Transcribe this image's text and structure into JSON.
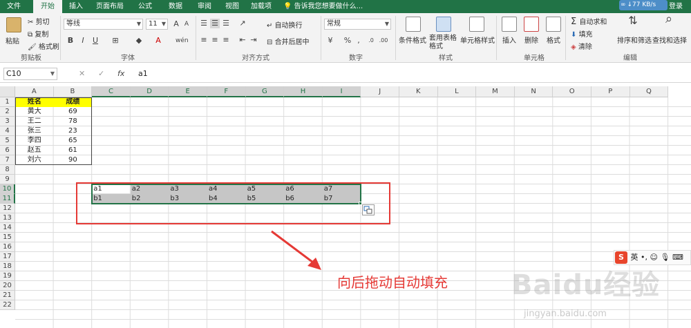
{
  "tabs": [
    "文件",
    "开始",
    "插入",
    "页面布局",
    "公式",
    "数据",
    "审阅",
    "视图",
    "加载项"
  ],
  "active_tab": "开始",
  "tell_me": "告诉我您想要做什么...",
  "network_speed": "77 KB/s",
  "login": "登录",
  "ribbon": {
    "clipboard": {
      "paste": "粘贴",
      "cut": "剪切",
      "copy": "复制",
      "format_painter": "格式刷",
      "label": "剪贴板"
    },
    "font": {
      "name": "等线",
      "size": "11",
      "bold": "B",
      "italic": "I",
      "underline": "U",
      "label": "字体"
    },
    "align": {
      "wrap": "自动换行",
      "merge": "合并后居中",
      "label": "对齐方式"
    },
    "number": {
      "format": "常规",
      "percent": "%",
      "comma": ",",
      "label": "数字"
    },
    "styles": {
      "conditional": "条件格式",
      "table": "套用表格格式",
      "cell_style": "单元格样式",
      "label": "样式"
    },
    "cells": {
      "insert": "插入",
      "delete": "删除",
      "format": "格式",
      "label": "单元格"
    },
    "editing": {
      "autosum": "自动求和",
      "fill": "填充",
      "clear": "清除",
      "sort": "排序和筛选",
      "find": "查找和选择",
      "label": "编辑"
    }
  },
  "formula_bar": {
    "name_box": "C10",
    "cancel": "✕",
    "enter": "✓",
    "fx": "fx",
    "value": "a1"
  },
  "columns": [
    "A",
    "B",
    "C",
    "D",
    "E",
    "F",
    "G",
    "H",
    "I",
    "J",
    "K",
    "L",
    "M",
    "N",
    "O",
    "P",
    "Q"
  ],
  "rows": [
    "1",
    "2",
    "3",
    "4",
    "5",
    "6",
    "7",
    "8",
    "9",
    "10",
    "11",
    "12",
    "13",
    "14",
    "15",
    "16",
    "17",
    "18",
    "19",
    "20",
    "21",
    "22"
  ],
  "table": {
    "headers": [
      "姓名",
      "成绩"
    ],
    "rows": [
      [
        "黄大",
        "69"
      ],
      [
        "王二",
        "78"
      ],
      [
        "张三",
        "23"
      ],
      [
        "李四",
        "65"
      ],
      [
        "赵五",
        "61"
      ],
      [
        "刘六",
        "90"
      ]
    ]
  },
  "fill_rows": [
    [
      "a1",
      "a2",
      "a3",
      "a4",
      "a5",
      "a6",
      "a7"
    ],
    [
      "b1",
      "b2",
      "b3",
      "b4",
      "b5",
      "b6",
      "b7"
    ]
  ],
  "annotation": "向后拖动自动填充",
  "ime": {
    "logo": "S",
    "lang": "英"
  },
  "watermark": "Baidu经验",
  "watermark_sub": "jingyan.baidu.com",
  "colors": {
    "excel_green": "#217346",
    "highlight_yellow": "#ffff00",
    "annotation_red": "#e53935"
  }
}
